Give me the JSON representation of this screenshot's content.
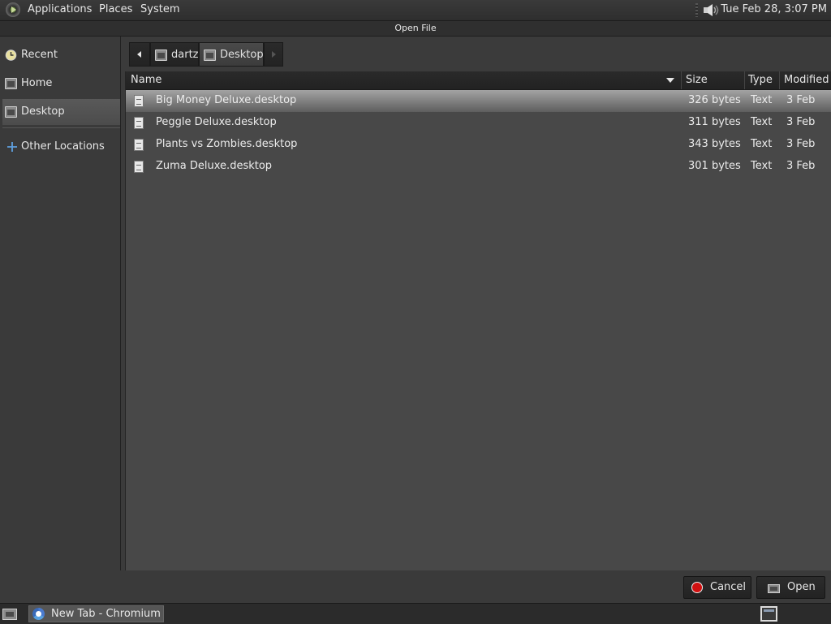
{
  "top_panel": {
    "menus": [
      "Applications",
      "Places",
      "System"
    ],
    "clock": "Tue Feb 28,  3:07 PM",
    "icons": [
      "distro-logo-icon",
      "volume-icon"
    ]
  },
  "window": {
    "title": "Open File"
  },
  "sidebar": {
    "items": [
      {
        "label": "Recent",
        "icon": "recent-icon"
      },
      {
        "label": "Home",
        "icon": "home-folder-icon"
      },
      {
        "label": "Desktop",
        "icon": "desktop-folder-icon",
        "active": true
      },
      {
        "label": "Other Locations",
        "icon": "plus-icon"
      }
    ]
  },
  "pathbar": {
    "segments": [
      {
        "label": "dartz",
        "icon": "home-folder-icon"
      },
      {
        "label": "Desktop",
        "icon": "desktop-folder-icon",
        "active": true
      }
    ]
  },
  "file_list": {
    "columns": [
      "Name",
      "Size",
      "Type",
      "Modified"
    ],
    "rows": [
      {
        "name": "Big Money Deluxe.desktop",
        "size": "326 bytes",
        "type": "Text",
        "modified": "3 Feb",
        "selected": true
      },
      {
        "name": "Peggle Deluxe.desktop",
        "size": "311 bytes",
        "type": "Text",
        "modified": "3 Feb"
      },
      {
        "name": "Plants vs Zombies.desktop",
        "size": "343 bytes",
        "type": "Text",
        "modified": "3 Feb"
      },
      {
        "name": "Zuma Deluxe.desktop",
        "size": "301 bytes",
        "type": "Text",
        "modified": "3 Feb"
      }
    ]
  },
  "buttons": {
    "cancel": "Cancel",
    "open": "Open"
  },
  "taskbar": {
    "tasks": [
      {
        "label": "New Tab - Chromium",
        "icon": "chromium-icon"
      }
    ]
  },
  "colors": {
    "selection": "#8a8a8a",
    "cancel_icon": "#d01010",
    "background": "#3b3b3b"
  }
}
